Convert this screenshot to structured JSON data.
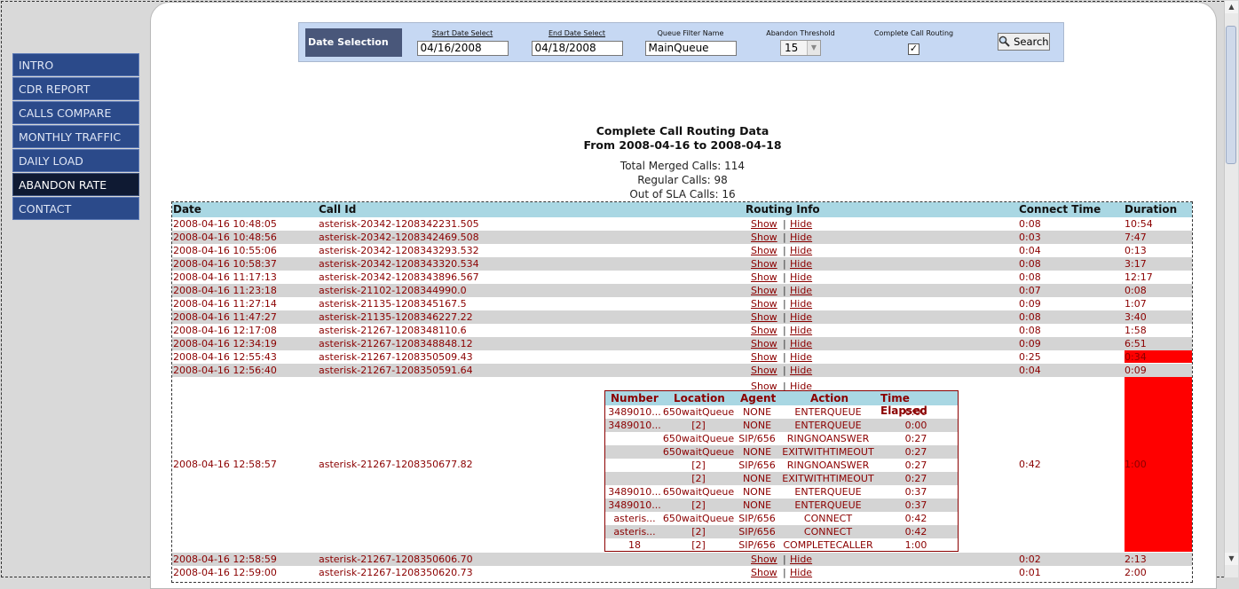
{
  "nav": {
    "items": [
      {
        "label": "INTRO"
      },
      {
        "label": "CDR REPORT"
      },
      {
        "label": "CALLS COMPARE"
      },
      {
        "label": "MONTHLY TRAFFIC"
      },
      {
        "label": "DAILY LOAD"
      },
      {
        "label": "ABANDON RATE",
        "active": true
      },
      {
        "label": "CONTACT"
      }
    ]
  },
  "datebar": {
    "title": "Date Selection",
    "start_label": "Start Date Select",
    "start_value": "04/16/2008",
    "end_label": "End Date Select",
    "end_value": "04/18/2008",
    "queue_label": "Queue Filter Name",
    "queue_value": "MainQueue",
    "threshold_label": "Abandon Threshold",
    "threshold_value": "15",
    "routing_label": "Complete Call Routing",
    "routing_checked": "✓",
    "search_label": "Search"
  },
  "report": {
    "title": "Complete Call Routing Data",
    "range": "From 2008-04-16 to 2008-04-18",
    "total": "Total Merged Calls: 114",
    "regular": "Regular Calls: 98",
    "outsla": "Out of SLA Calls: 16"
  },
  "table": {
    "headers": {
      "date": "Date",
      "callid": "Call Id",
      "routing": "Routing Info",
      "connect": "Connect Time",
      "duration": "Duration"
    },
    "show": "Show",
    "sep": "|",
    "hide": "Hide",
    "rows": [
      {
        "date": "2008-04-16 10:48:05",
        "callid": "asterisk-20342-1208342231.505",
        "connect": "0:08",
        "duration": "10:54"
      },
      {
        "date": "2008-04-16 10:48:56",
        "callid": "asterisk-20342-1208342469.508",
        "connect": "0:03",
        "duration": "7:47"
      },
      {
        "date": "2008-04-16 10:55:06",
        "callid": "asterisk-20342-1208343293.532",
        "connect": "0:04",
        "duration": "0:13"
      },
      {
        "date": "2008-04-16 10:58:37",
        "callid": "asterisk-20342-1208343320.534",
        "connect": "0:08",
        "duration": "3:17"
      },
      {
        "date": "2008-04-16 11:17:13",
        "callid": "asterisk-20342-1208343896.567",
        "connect": "0:08",
        "duration": "12:17"
      },
      {
        "date": "2008-04-16 11:23:18",
        "callid": "asterisk-21102-1208344990.0",
        "connect": "0:07",
        "duration": "0:08"
      },
      {
        "date": "2008-04-16 11:27:14",
        "callid": "asterisk-21135-1208345167.5",
        "connect": "0:09",
        "duration": "1:07"
      },
      {
        "date": "2008-04-16 11:47:27",
        "callid": "asterisk-21135-1208346227.22",
        "connect": "0:08",
        "duration": "3:40"
      },
      {
        "date": "2008-04-16 12:17:08",
        "callid": "asterisk-21267-1208348110.6",
        "connect": "0:08",
        "duration": "1:58"
      },
      {
        "date": "2008-04-16 12:34:19",
        "callid": "asterisk-21267-1208348848.12",
        "connect": "0:09",
        "duration": "6:51"
      },
      {
        "date": "2008-04-16 12:55:43",
        "callid": "asterisk-21267-1208350509.43",
        "connect": "0:25",
        "duration": "0:34"
      },
      {
        "date": "2008-04-16 12:56:40",
        "callid": "asterisk-21267-1208350591.64",
        "connect": "0:04",
        "duration": "0:09"
      }
    ],
    "expanded": {
      "date": "2008-04-16 12:58:57",
      "callid": "asterisk-21267-1208350677.82",
      "connect": "0:42",
      "duration": "1:00"
    },
    "after_rows": [
      {
        "date": "2008-04-16 12:58:59",
        "callid": "asterisk-21267-1208350606.70",
        "connect": "0:02",
        "duration": "2:13"
      },
      {
        "date": "2008-04-16 12:59:00",
        "callid": "asterisk-21267-1208350620.73",
        "connect": "0:01",
        "duration": "2:00"
      }
    ]
  },
  "routing": {
    "headers": {
      "number": "Number",
      "location": "Location",
      "agent": "Agent",
      "action": "Action",
      "elapsed": "Time Elapsed"
    },
    "rows": [
      {
        "number": "3489010...",
        "location": "650waitQueue",
        "agent": "NONE",
        "action": "ENTERQUEUE",
        "elapsed": "0:00"
      },
      {
        "number": "3489010...",
        "location": "[2]",
        "agent": "NONE",
        "action": "ENTERQUEUE",
        "elapsed": "0:00"
      },
      {
        "number": "",
        "location": "650waitQueue",
        "agent": "SIP/656",
        "action": "RINGNOANSWER",
        "elapsed": "0:27"
      },
      {
        "number": "",
        "location": "650waitQueue",
        "agent": "NONE",
        "action": "EXITWITHTIMEOUT",
        "elapsed": "0:27"
      },
      {
        "number": "",
        "location": "[2]",
        "agent": "SIP/656",
        "action": "RINGNOANSWER",
        "elapsed": "0:27"
      },
      {
        "number": "",
        "location": "[2]",
        "agent": "NONE",
        "action": "EXITWITHTIMEOUT",
        "elapsed": "0:27"
      },
      {
        "number": "3489010...",
        "location": "650waitQueue",
        "agent": "NONE",
        "action": "ENTERQUEUE",
        "elapsed": "0:37"
      },
      {
        "number": "3489010...",
        "location": "[2]",
        "agent": "NONE",
        "action": "ENTERQUEUE",
        "elapsed": "0:37"
      },
      {
        "number": "asteris...",
        "location": "650waitQueue",
        "agent": "SIP/656",
        "action": "CONNECT",
        "elapsed": "0:42"
      },
      {
        "number": "asteris...",
        "location": "[2]",
        "agent": "SIP/656",
        "action": "CONNECT",
        "elapsed": "0:42"
      },
      {
        "number": "18",
        "location": "[2]",
        "agent": "SIP/656",
        "action": "COMPLETECALLER",
        "elapsed": "1:00"
      }
    ]
  },
  "colors": {
    "accent_red": "#ff0000",
    "row_text": "#8b0000",
    "header_bg": "#a9d7e3",
    "nav_bg": "#2b4a8a"
  }
}
